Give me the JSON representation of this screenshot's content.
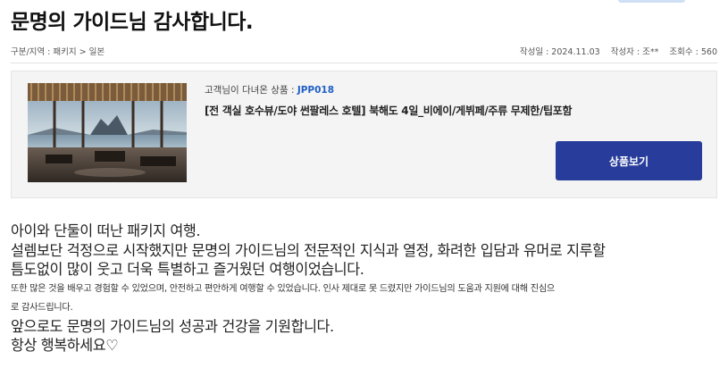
{
  "page": {
    "title": "문명의 가이드님 감사합니다."
  },
  "meta": {
    "breadcrumb": "구분/지역 : 패키지 > 일본",
    "date": "작성일 : 2024.11.03",
    "author": "작성자 : 조**",
    "views": "조회수 : 560"
  },
  "product": {
    "label_prefix": "고객님이 다녀온 상품 : ",
    "code": "JPP018",
    "name": "[전 객실 호수뷰/도야 썬팔레스 호텔] 북해도 4일_비에이/게뷔페/주류 무제한/팁포함",
    "button_label": "상품보기",
    "thumbnail_icon": "hotel-lobby-lake-view-image"
  },
  "review": {
    "lines": [
      "아이와 단둘이 떠난 패키지 여행.",
      "설렘보단 걱정으로 시작했지만 문명의 가이드님의 전문적인 지식과 열정, 화려한 입담과 유머로 지루할",
      "틈도없이 많이 웃고 더욱 특별하고 즐거웠던 여행이었습니다.",
      "또한 많은 것을 배우고 경험할 수 있었으며, 안전하고 편안하게 여행할 수 있었습니다. 인사 제대로 못 드렸지만 가이드님의 도움과 지원에 대해 진심으",
      "로 감사드립니다.",
      "앞으로도 문명의 가이드님의 성공과 건강을 기원합니다.",
      "항상 행복하세요♡"
    ]
  },
  "colors": {
    "accent_button": "#283d9b",
    "code_link": "#1f5fc4",
    "box_background": "#f4f4f4"
  }
}
